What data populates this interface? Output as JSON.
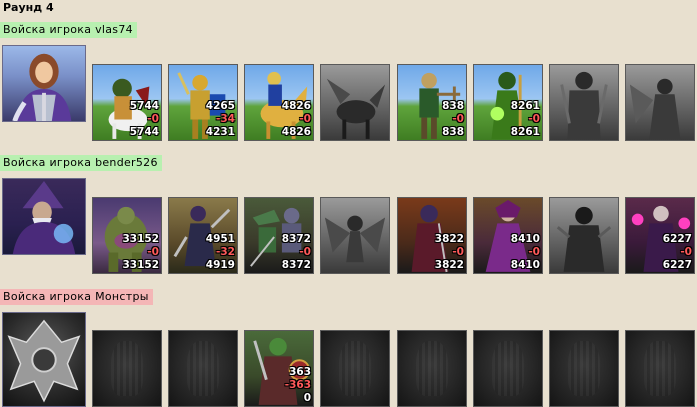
{
  "round": {
    "title": "Раунд 4"
  },
  "armies": [
    {
      "label": "Войска игрока vlas74",
      "label_color": "#b8f0b0",
      "hero": {
        "icon": "knight-heroine-portrait-icon"
      },
      "units": [
        {
          "icon": "unicorn-rider-icon",
          "count": "5744",
          "loss": "-0",
          "remain": "5744"
        },
        {
          "icon": "golden-knight-icon",
          "count": "4265",
          "loss": "-34",
          "remain": "4231"
        },
        {
          "icon": "cavalier-icon",
          "count": "4826",
          "loss": "-0",
          "remain": "4826"
        },
        {
          "icon": "pegasus-icon",
          "dead": true
        },
        {
          "icon": "crossbowman-icon",
          "count": "838",
          "loss": "-0",
          "remain": "838"
        },
        {
          "icon": "priest-icon",
          "count": "8261",
          "loss": "-0",
          "remain": "8261"
        },
        {
          "icon": "swordsman-icon",
          "dead": true
        },
        {
          "icon": "angel-icon",
          "dead": true
        }
      ]
    },
    {
      "label": "Войска игрока bender526",
      "label_color": "#b8f0b0",
      "hero": {
        "icon": "wizard-portrait-icon"
      },
      "units": [
        {
          "icon": "troll-icon",
          "count": "33152",
          "loss": "-0",
          "remain": "33152"
        },
        {
          "icon": "dark-assassin-icon",
          "count": "4951",
          "loss": "-32",
          "remain": "4919"
        },
        {
          "icon": "lizard-warrior-icon",
          "count": "8372",
          "loss": "-0",
          "remain": "8372"
        },
        {
          "icon": "harpy-icon",
          "dead": true
        },
        {
          "icon": "dark-knight-icon",
          "count": "3822",
          "loss": "-0",
          "remain": "3822"
        },
        {
          "icon": "sorceress-icon",
          "count": "8410",
          "loss": "-0",
          "remain": "8410"
        },
        {
          "icon": "shadow-warrior-icon",
          "dead": true
        },
        {
          "icon": "warlock-icon",
          "count": "6227",
          "loss": "-0",
          "remain": "6227"
        }
      ]
    },
    {
      "label": "Войска игрока Монстры",
      "label_color": "#f4b6b6",
      "hero": {
        "icon": "monster-crest-icon"
      },
      "units": [
        {
          "icon": "empty-slot-icon",
          "empty": true
        },
        {
          "icon": "empty-slot-icon",
          "empty": true
        },
        {
          "icon": "orc-warrior-icon",
          "count": "363",
          "loss": "-363",
          "remain": "0"
        },
        {
          "icon": "empty-slot-icon",
          "empty": true
        },
        {
          "icon": "empty-slot-icon",
          "empty": true
        },
        {
          "icon": "empty-slot-icon",
          "empty": true
        },
        {
          "icon": "empty-slot-icon",
          "empty": true
        },
        {
          "icon": "empty-slot-icon",
          "empty": true
        }
      ]
    }
  ]
}
